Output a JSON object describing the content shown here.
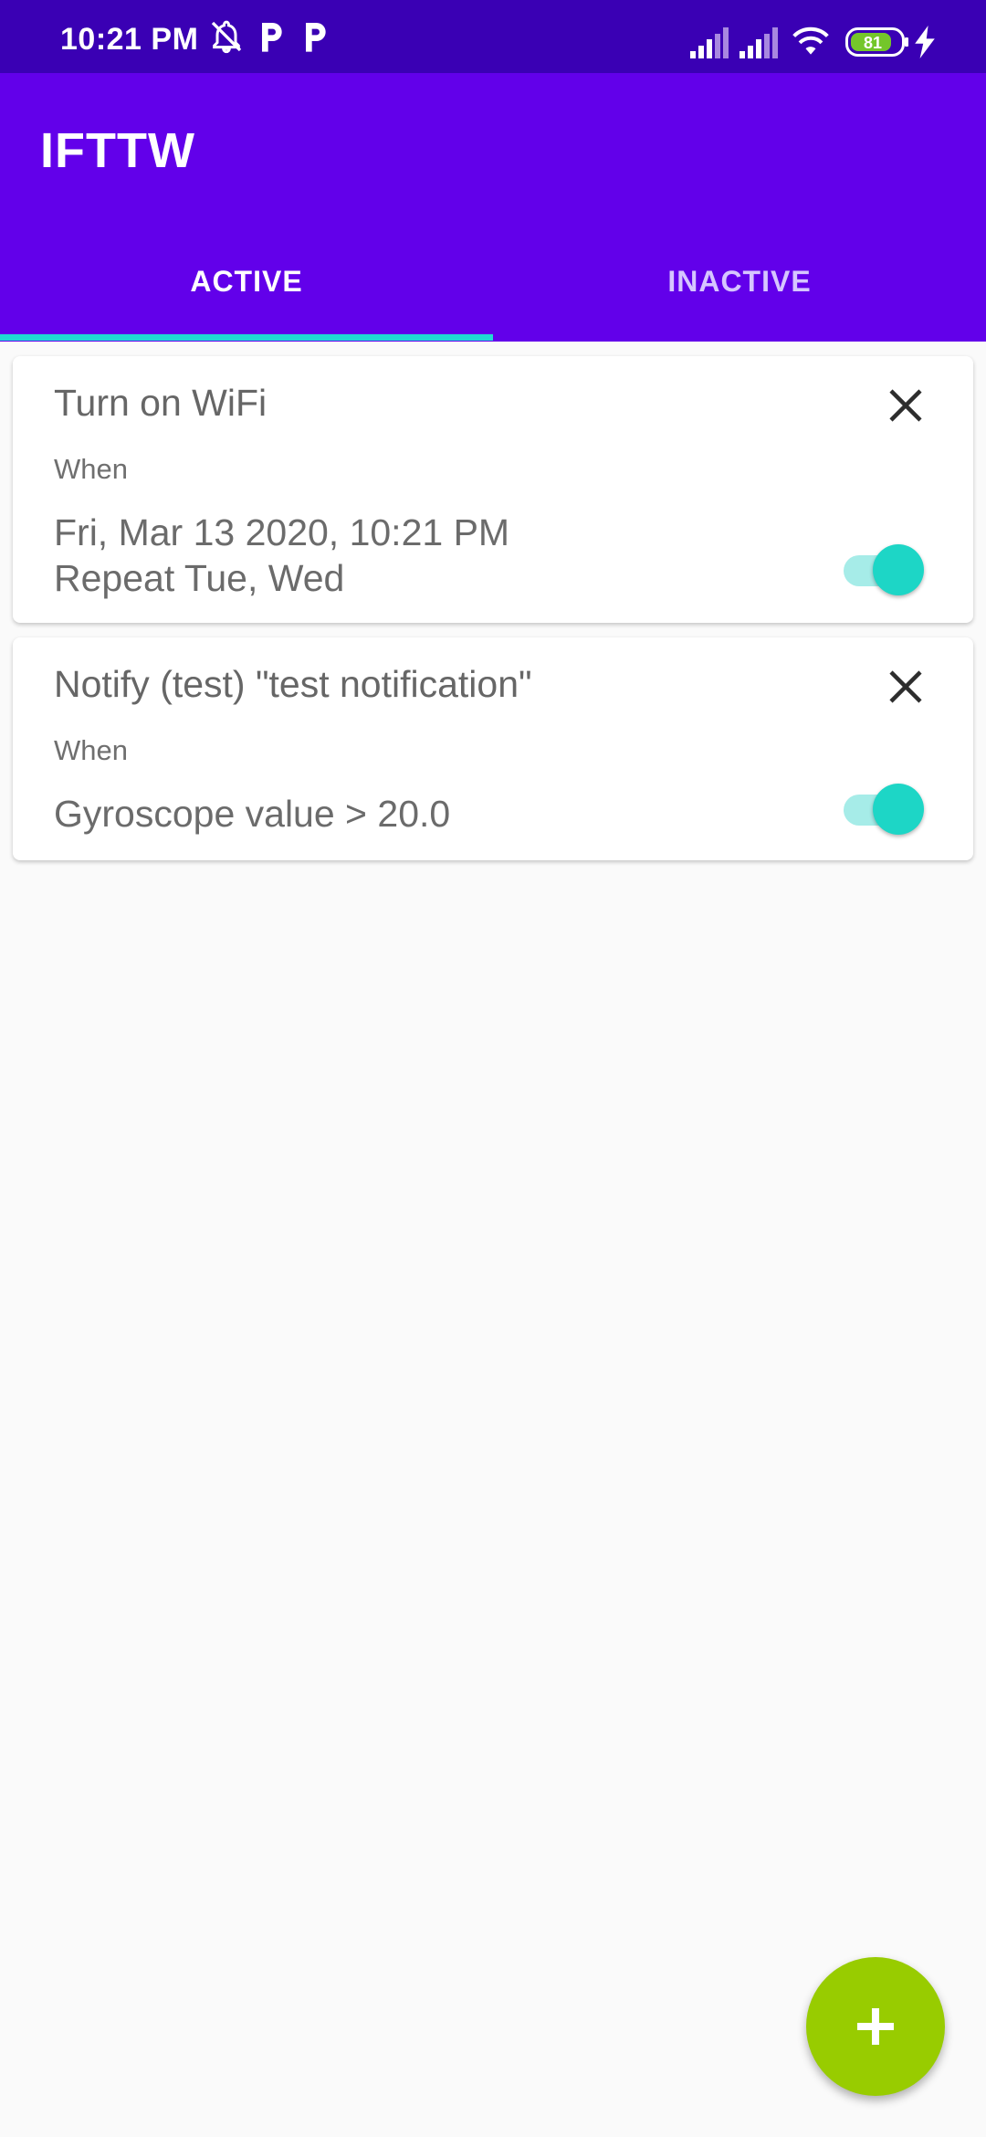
{
  "status_bar": {
    "time": "10:21 PM",
    "battery_level": "81",
    "icons": [
      "notifications-off-icon",
      "p-app-icon",
      "p-app-icon",
      "signal-icon",
      "signal-icon",
      "wifi-icon",
      "battery-icon",
      "charging-icon"
    ]
  },
  "app_bar": {
    "title": "IFTTW",
    "tabs": [
      {
        "label": "ACTIVE",
        "selected": true
      },
      {
        "label": "INACTIVE",
        "selected": false
      }
    ]
  },
  "rules": [
    {
      "title": "Turn on WiFi",
      "when_label": "When",
      "condition_lines": [
        "Fri, Mar 13 2020, 10:21 PM",
        "Repeat  Tue, Wed"
      ],
      "enabled": true
    },
    {
      "title": "Notify (test) \"test notification\"",
      "when_label": "When",
      "condition_lines": [
        "Gyroscope value > 20.0"
      ],
      "enabled": true
    }
  ],
  "colors": {
    "status_bar": "#3a00b4",
    "app_bar": "#6200ea",
    "tab_indicator": "#20dad2",
    "toggle_on": "#1dd6c6",
    "fab": "#98cc00",
    "background": "#fafafa"
  },
  "fab": {
    "icon": "plus-icon"
  }
}
